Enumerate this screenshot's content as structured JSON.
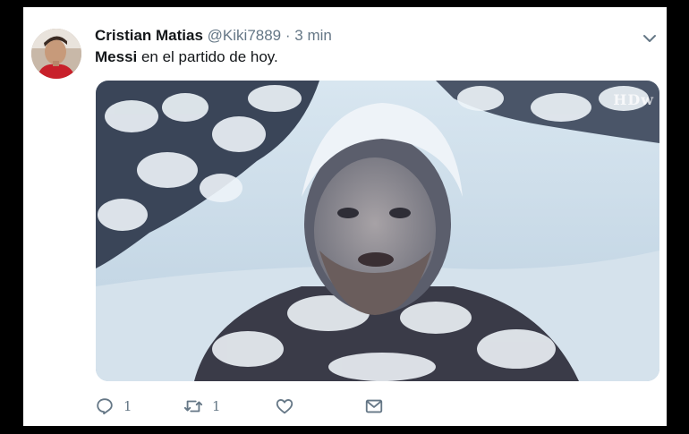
{
  "tweet": {
    "author_name": "Cristian Matias",
    "handle": "@Kiki7889",
    "separator": "·",
    "time": "3 min",
    "text_bold": "Messi",
    "text_rest": " en el partido de hoy.",
    "media_watermark": "HDw"
  },
  "actions": {
    "reply_count": "1",
    "retweet_count": "1"
  },
  "icons": {
    "reply": "reply-icon",
    "retweet": "retweet-icon",
    "like": "heart-icon",
    "dm": "envelope-icon",
    "more": "chevron-down-icon"
  },
  "colors": {
    "text": "#14171a",
    "secondary": "#657786",
    "background": "#ffffff",
    "outer": "#000000"
  }
}
